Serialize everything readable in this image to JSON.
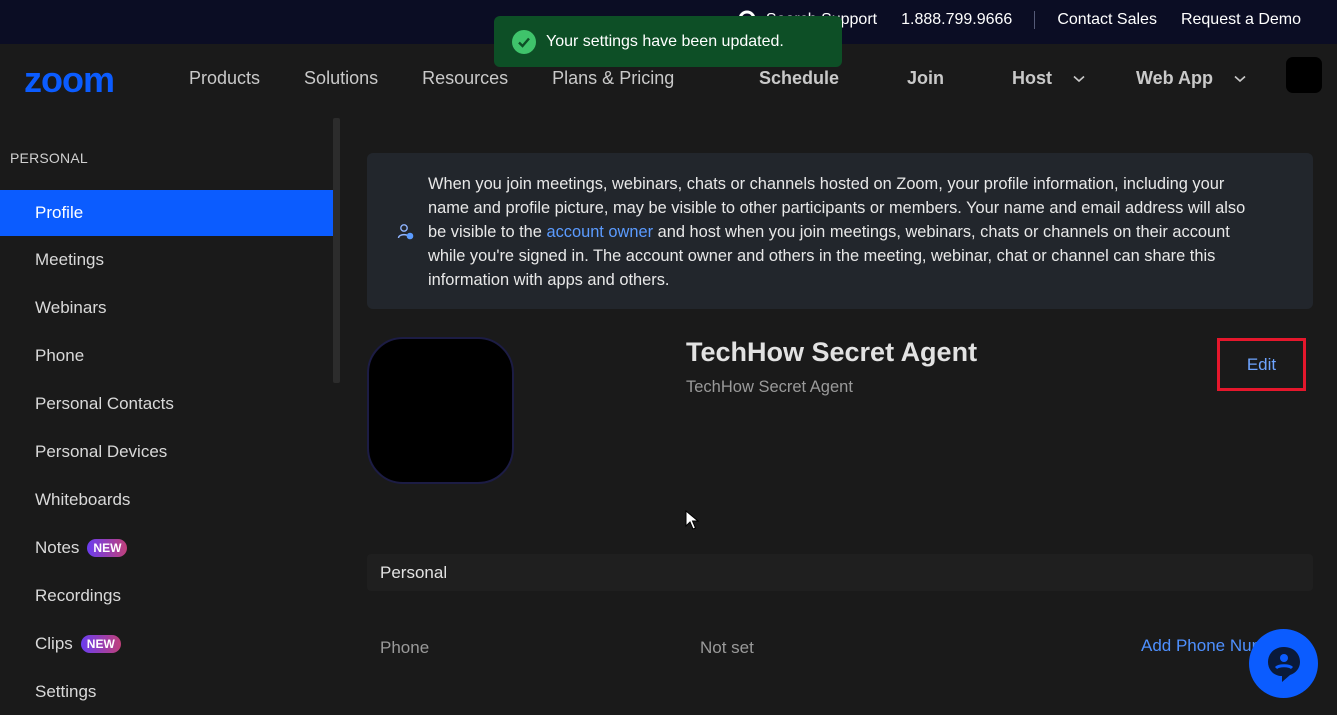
{
  "topbar": {
    "search_support": "Search  Support",
    "phone": "1.888.799.9666",
    "contact_sales": "Contact Sales",
    "request_demo": "Request a Demo"
  },
  "toast": {
    "message": "Your settings have been updated.",
    "icon": "check-circle-icon"
  },
  "navbar": {
    "logo": "zoom",
    "left_items": [
      "Products",
      "Solutions",
      "Resources",
      "Plans & Pricing"
    ],
    "right_items": {
      "schedule": "Schedule",
      "join": "Join",
      "host": "Host",
      "web_app": "Web App"
    }
  },
  "sidebar": {
    "heading": "PERSONAL",
    "items": [
      {
        "label": "Profile",
        "active": true
      },
      {
        "label": "Meetings"
      },
      {
        "label": "Webinars"
      },
      {
        "label": "Phone"
      },
      {
        "label": "Personal Contacts"
      },
      {
        "label": "Personal Devices"
      },
      {
        "label": "Whiteboards"
      },
      {
        "label": "Notes",
        "badge": "NEW"
      },
      {
        "label": "Recordings"
      },
      {
        "label": "Clips",
        "badge": "NEW"
      },
      {
        "label": "Settings"
      }
    ]
  },
  "notice": {
    "text_before": "When you join meetings, webinars, chats or channels hosted on Zoom, your profile information, including your name and profile picture, may be visible to other participants or members. Your name and email address will also be visible to the ",
    "link": "account owner",
    "text_after": " and host when you join meetings, webinars, chats or channels on their account while you're signed in. The account owner and others in the meeting, webinar, chat or channel can share this information with apps and others."
  },
  "profile": {
    "name": "TechHow Secret Agent",
    "display_name": "TechHow Secret Agent",
    "edit": "Edit"
  },
  "personal_section": {
    "title": "Personal",
    "fields": [
      {
        "label": "Phone",
        "value": "Not set",
        "action": "Add Phone Number"
      }
    ]
  },
  "colors": {
    "accent": "#0b5cff",
    "toast_bg": "#0d4f26",
    "highlight_border": "#e5172c"
  }
}
